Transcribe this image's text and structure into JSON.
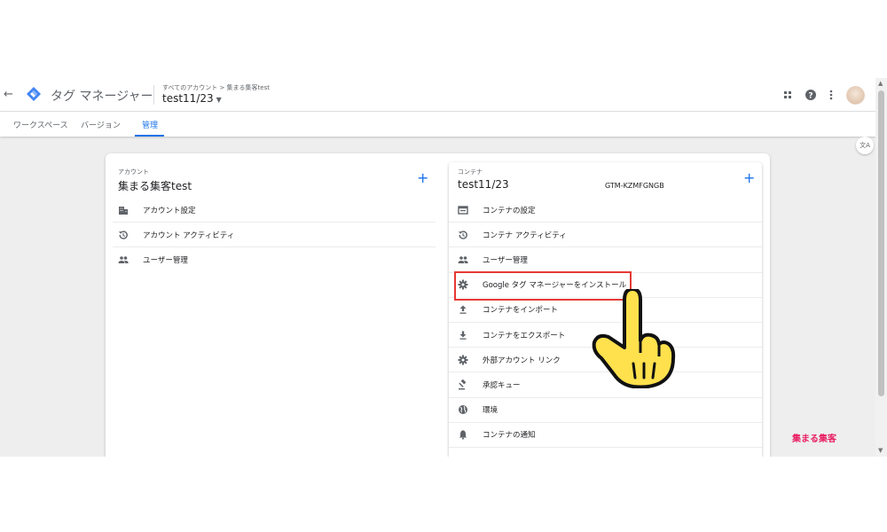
{
  "header": {
    "app_name": "タグ マネージャー",
    "breadcrumb": "すべてのアカウント > 集まる集客test",
    "container_name": "test11/23"
  },
  "tabs": [
    {
      "label": "ワークスペース",
      "active": false
    },
    {
      "label": "バージョン",
      "active": false
    },
    {
      "label": "管理",
      "active": true
    }
  ],
  "account": {
    "section_label": "アカウント",
    "name": "集まる集客test",
    "items": [
      {
        "label": "アカウント設定",
        "icon": "building-icon"
      },
      {
        "label": "アカウント アクティビティ",
        "icon": "history-icon"
      },
      {
        "label": "ユーザー管理",
        "icon": "people-icon"
      }
    ]
  },
  "container": {
    "section_label": "コンテナ",
    "name": "test11/23",
    "id": "GTM-KZMFGNGB",
    "items": [
      {
        "label": "コンテナの設定",
        "icon": "settings-panel-icon"
      },
      {
        "label": "コンテナ アクティビティ",
        "icon": "history-icon"
      },
      {
        "label": "ユーザー管理",
        "icon": "people-icon"
      },
      {
        "label": "Google タグ マネージャーをインストール",
        "icon": "gear-icon"
      },
      {
        "label": "コンテナをインポート",
        "icon": "upload-icon"
      },
      {
        "label": "コンテナをエクスポート",
        "icon": "download-icon"
      },
      {
        "label": "外部アカウント リンク",
        "icon": "gear-icon"
      },
      {
        "label": "承認キュー",
        "icon": "gavel-icon"
      },
      {
        "label": "環境",
        "icon": "globe-icon"
      },
      {
        "label": "コンテナの通知",
        "icon": "bell-icon"
      }
    ]
  },
  "colors": {
    "accent": "#1a73e8",
    "highlight": "#e53935",
    "pointer_fill": "#ffe14d"
  },
  "brand": {
    "text": "集まる集客"
  }
}
